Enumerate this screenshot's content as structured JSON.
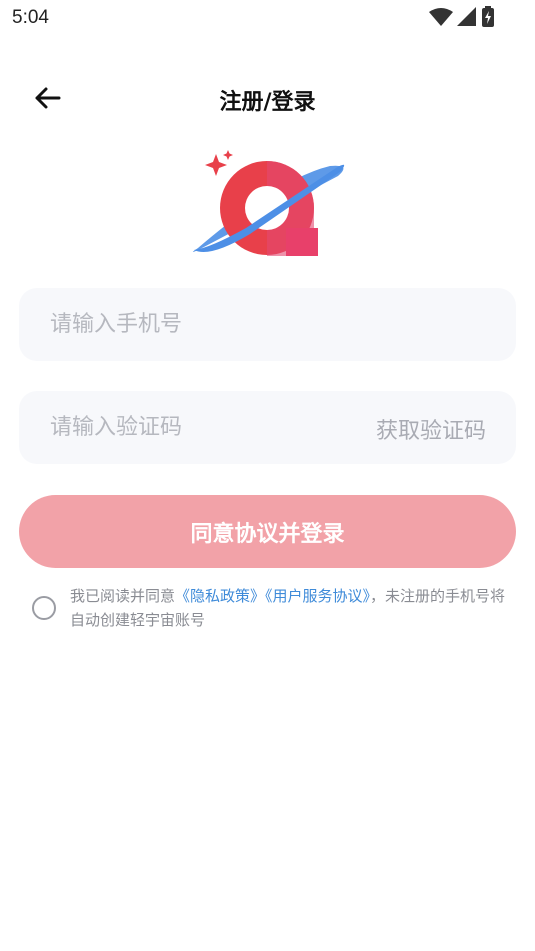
{
  "status_bar": {
    "time": "5:04"
  },
  "header": {
    "title": "注册/登录"
  },
  "form": {
    "phone_placeholder": "请输入手机号",
    "code_placeholder": "请输入验证码",
    "get_code_label": "获取验证码",
    "submit_label": "同意协议并登录"
  },
  "agreement": {
    "prefix": "我已阅读并同意",
    "privacy_link": "《隐私政策》",
    "user_link": "《用户服务协议》",
    "suffix": "，未注册的手机号将自动创建轻宇宙账号"
  },
  "colors": {
    "accent": "#f2a2a8",
    "link": "#3f8bd9",
    "logo_red": "#e8404a",
    "logo_blue": "#4d8fe6"
  }
}
